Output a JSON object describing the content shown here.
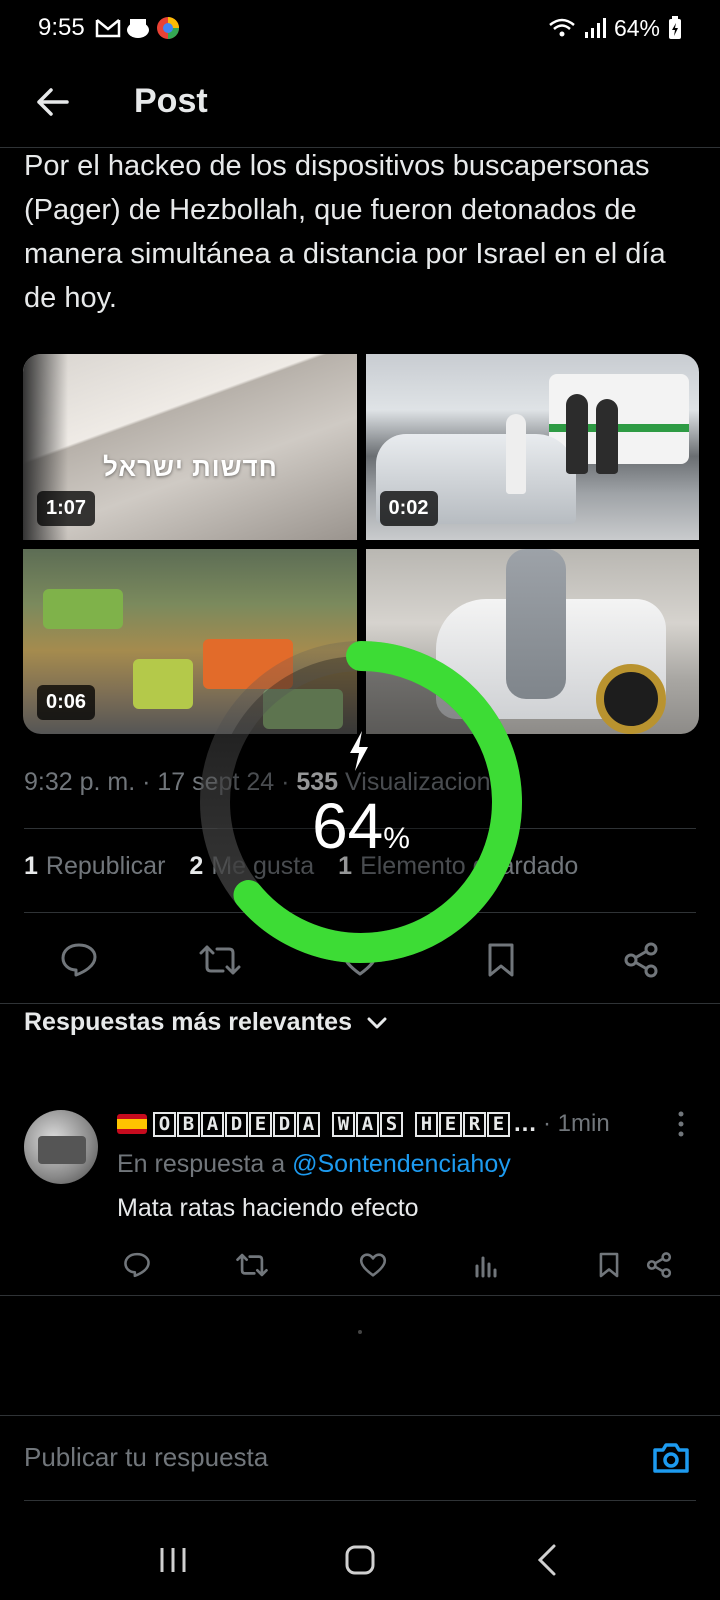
{
  "status_bar": {
    "time": "9:55",
    "battery": "64%"
  },
  "header": {
    "title": "Post"
  },
  "post": {
    "text": "Por el hackeo de los dispositivos buscapersonas (Pager) de Hezbollah, que fueron detonados de manera simultánea a distancia por Israel en el día de hoy.",
    "media": [
      {
        "duration": "1:07",
        "overlay_text": "חדשות ישראל"
      },
      {
        "duration": "0:02"
      },
      {
        "duration": "0:06"
      },
      {
        "duration": ""
      }
    ],
    "timestamp": "9:32 p. m.",
    "date": "17 sept 24",
    "views_count": "535",
    "views_label": "Visualizaciones",
    "reposts_count": "1",
    "reposts_label": "Republicar",
    "likes_count": "2",
    "likes_label": "Me gusta",
    "bookmarks_count": "1",
    "bookmarks_label": "Elemento guardado"
  },
  "replies": {
    "header": "Respuestas más relevantes",
    "items": [
      {
        "name_letters_1": [
          "O",
          "B",
          "A",
          "D",
          "E",
          "D",
          "A"
        ],
        "name_letters_2": [
          "W",
          "A",
          "S"
        ],
        "name_letters_3": [
          "H",
          "E",
          "R",
          "E"
        ],
        "name_ellipsis": "…",
        "time": "· 1min",
        "in_reply_prefix": "En respuesta a",
        "in_reply_handle": "@Sontendenciahoy",
        "text": "Mata ratas haciendo efecto"
      }
    ]
  },
  "compose": {
    "placeholder": "Publicar tu respuesta"
  },
  "charging": {
    "percent": "64",
    "percent_sign": "%",
    "level": 0.64,
    "ring_color": "#3ddc35"
  },
  "colors": {
    "accent": "#1d9bf0",
    "text": "#e7e9ea",
    "muted": "#71767b"
  }
}
